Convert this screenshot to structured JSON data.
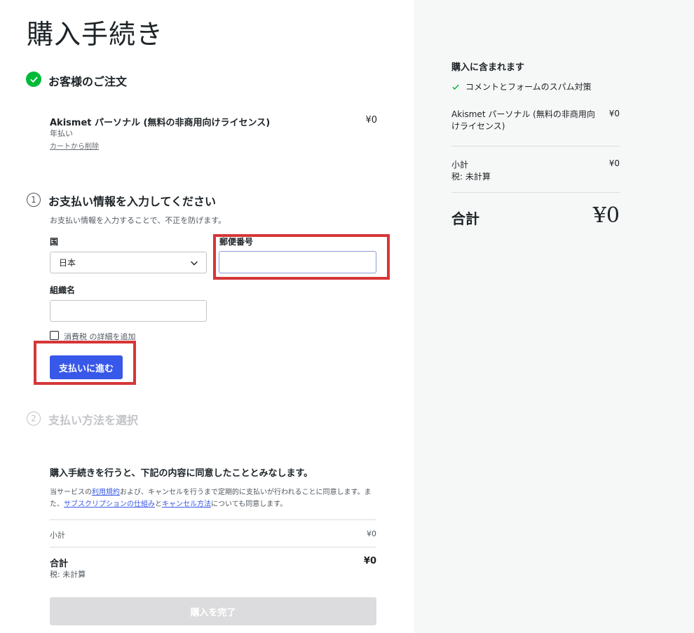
{
  "page": {
    "title": "購入手続き"
  },
  "order": {
    "heading": "お客様のご注文",
    "product_name": "Akismet パーソナル (無料の非商用向けライセンス)",
    "product_price": "¥0",
    "billing_period": "年払い",
    "remove_link": "カートから削除"
  },
  "payment_info": {
    "step_number": "1",
    "heading": "お支払い情報を入力してください",
    "description": "お支払い情報を入力することで、不正を防げます。",
    "country_label": "国",
    "country_value": "日本",
    "postal_label": "郵便番号",
    "postal_value": "",
    "org_label": "組織名",
    "org_value": "",
    "tax_checkbox_label": "消費税 の詳細を追加",
    "continue_button": "支払いに進む"
  },
  "payment_method": {
    "step_number": "2",
    "heading": "支払い方法を選択"
  },
  "terms": {
    "heading": "購入手続きを行うと、下記の内容に同意したこととみなします。",
    "text_1": "当サービスの",
    "link_tos": "利用規約",
    "text_2": "および、キャンセルを行うまで定期的に支払いが行われることに同意します。また、",
    "link_subscriptions": "サブスクリプションの仕組み",
    "text_3": "と",
    "link_cancel": "キャンセル方法",
    "text_4": "についても同意します。"
  },
  "summary": {
    "subtotal_label": "小計",
    "subtotal_value": "¥0",
    "total_label": "合計",
    "total_value": "¥0",
    "tax_note": "税: 未計算",
    "complete_button": "購入を完了"
  },
  "sidebar": {
    "heading": "購入に含まれます",
    "feature": "コメントとフォームのスパム対策",
    "product_name": "Akismet パーソナル (無料の非商用向けライセンス)",
    "product_price": "¥0",
    "subtotal_label": "小計",
    "subtotal_value": "¥0",
    "tax_note": "税: 未計算",
    "total_label": "合計",
    "total_value": "¥0"
  },
  "colors": {
    "accent": "#3858e9",
    "success": "#00ba37",
    "highlight": "#d63638",
    "sidebar_bg": "#f6f7f7"
  }
}
